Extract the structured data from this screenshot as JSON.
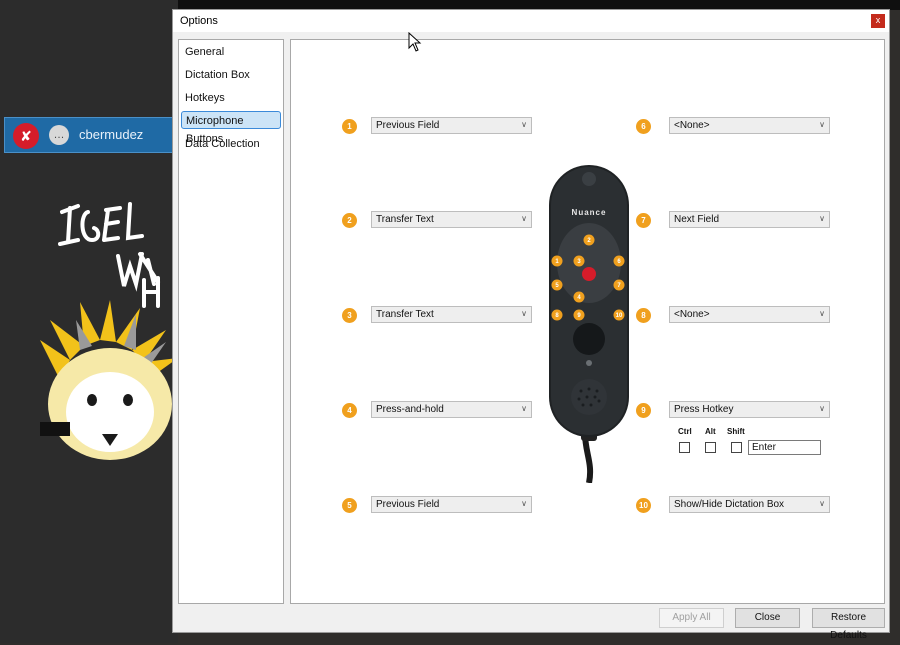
{
  "background": {
    "user_name": "cbermudez",
    "mic_icon": "mic-muted-icon",
    "chat_icon": "chat-icon"
  },
  "dialog": {
    "title": "Options",
    "close_label": "x"
  },
  "nav": {
    "items": [
      {
        "label": "General"
      },
      {
        "label": "Dictation Box"
      },
      {
        "label": "Hotkeys"
      },
      {
        "label": "Microphone Buttons",
        "active": true
      },
      {
        "label": "Data Collection"
      }
    ]
  },
  "buttons_left": [
    {
      "num": "1",
      "value": "Previous Field"
    },
    {
      "num": "2",
      "value": "Transfer Text"
    },
    {
      "num": "3",
      "value": "Transfer Text"
    },
    {
      "num": "4",
      "value": "Press-and-hold"
    },
    {
      "num": "5",
      "value": "Previous Field"
    }
  ],
  "buttons_right": [
    {
      "num": "6",
      "value": "<None>"
    },
    {
      "num": "7",
      "value": "Next Field"
    },
    {
      "num": "8",
      "value": "<None>"
    },
    {
      "num": "9",
      "value": "Press Hotkey"
    },
    {
      "num": "10",
      "value": "Show/Hide Dictation Box"
    }
  ],
  "hotkey": {
    "ctrl_label": "Ctrl",
    "alt_label": "Alt",
    "shift_label": "Shift",
    "ctrl_checked": false,
    "alt_checked": false,
    "shift_checked": false,
    "key_value": "Enter"
  },
  "device": {
    "brand": "Nuance",
    "badges": [
      "1",
      "2",
      "3",
      "4",
      "5",
      "6",
      "7",
      "8",
      "9",
      "10"
    ]
  },
  "footer": {
    "apply_all": "Apply All",
    "close": "Close",
    "restore_defaults": "Restore Defaults"
  },
  "colors": {
    "badge": "#f0a01e",
    "selected_nav": "#cce4f7",
    "selected_nav_border": "#3b8ad9",
    "user_bar": "#1f6aa5",
    "record_button": "#d51c2a"
  }
}
